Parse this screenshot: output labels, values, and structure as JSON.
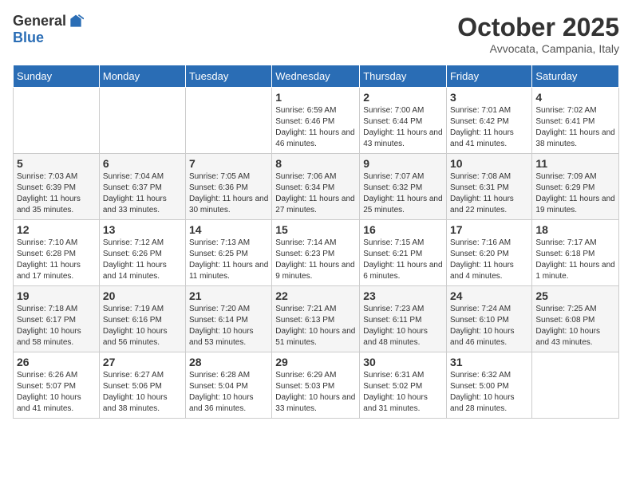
{
  "logo": {
    "general": "General",
    "blue": "Blue"
  },
  "title": "October 2025",
  "subtitle": "Avvocata, Campania, Italy",
  "days_of_week": [
    "Sunday",
    "Monday",
    "Tuesday",
    "Wednesday",
    "Thursday",
    "Friday",
    "Saturday"
  ],
  "weeks": [
    [
      {
        "day": "",
        "info": ""
      },
      {
        "day": "",
        "info": ""
      },
      {
        "day": "",
        "info": ""
      },
      {
        "day": "1",
        "info": "Sunrise: 6:59 AM\nSunset: 6:46 PM\nDaylight: 11 hours and 46 minutes."
      },
      {
        "day": "2",
        "info": "Sunrise: 7:00 AM\nSunset: 6:44 PM\nDaylight: 11 hours and 43 minutes."
      },
      {
        "day": "3",
        "info": "Sunrise: 7:01 AM\nSunset: 6:42 PM\nDaylight: 11 hours and 41 minutes."
      },
      {
        "day": "4",
        "info": "Sunrise: 7:02 AM\nSunset: 6:41 PM\nDaylight: 11 hours and 38 minutes."
      }
    ],
    [
      {
        "day": "5",
        "info": "Sunrise: 7:03 AM\nSunset: 6:39 PM\nDaylight: 11 hours and 35 minutes."
      },
      {
        "day": "6",
        "info": "Sunrise: 7:04 AM\nSunset: 6:37 PM\nDaylight: 11 hours and 33 minutes."
      },
      {
        "day": "7",
        "info": "Sunrise: 7:05 AM\nSunset: 6:36 PM\nDaylight: 11 hours and 30 minutes."
      },
      {
        "day": "8",
        "info": "Sunrise: 7:06 AM\nSunset: 6:34 PM\nDaylight: 11 hours and 27 minutes."
      },
      {
        "day": "9",
        "info": "Sunrise: 7:07 AM\nSunset: 6:32 PM\nDaylight: 11 hours and 25 minutes."
      },
      {
        "day": "10",
        "info": "Sunrise: 7:08 AM\nSunset: 6:31 PM\nDaylight: 11 hours and 22 minutes."
      },
      {
        "day": "11",
        "info": "Sunrise: 7:09 AM\nSunset: 6:29 PM\nDaylight: 11 hours and 19 minutes."
      }
    ],
    [
      {
        "day": "12",
        "info": "Sunrise: 7:10 AM\nSunset: 6:28 PM\nDaylight: 11 hours and 17 minutes."
      },
      {
        "day": "13",
        "info": "Sunrise: 7:12 AM\nSunset: 6:26 PM\nDaylight: 11 hours and 14 minutes."
      },
      {
        "day": "14",
        "info": "Sunrise: 7:13 AM\nSunset: 6:25 PM\nDaylight: 11 hours and 11 minutes."
      },
      {
        "day": "15",
        "info": "Sunrise: 7:14 AM\nSunset: 6:23 PM\nDaylight: 11 hours and 9 minutes."
      },
      {
        "day": "16",
        "info": "Sunrise: 7:15 AM\nSunset: 6:21 PM\nDaylight: 11 hours and 6 minutes."
      },
      {
        "day": "17",
        "info": "Sunrise: 7:16 AM\nSunset: 6:20 PM\nDaylight: 11 hours and 4 minutes."
      },
      {
        "day": "18",
        "info": "Sunrise: 7:17 AM\nSunset: 6:18 PM\nDaylight: 11 hours and 1 minute."
      }
    ],
    [
      {
        "day": "19",
        "info": "Sunrise: 7:18 AM\nSunset: 6:17 PM\nDaylight: 10 hours and 58 minutes."
      },
      {
        "day": "20",
        "info": "Sunrise: 7:19 AM\nSunset: 6:16 PM\nDaylight: 10 hours and 56 minutes."
      },
      {
        "day": "21",
        "info": "Sunrise: 7:20 AM\nSunset: 6:14 PM\nDaylight: 10 hours and 53 minutes."
      },
      {
        "day": "22",
        "info": "Sunrise: 7:21 AM\nSunset: 6:13 PM\nDaylight: 10 hours and 51 minutes."
      },
      {
        "day": "23",
        "info": "Sunrise: 7:23 AM\nSunset: 6:11 PM\nDaylight: 10 hours and 48 minutes."
      },
      {
        "day": "24",
        "info": "Sunrise: 7:24 AM\nSunset: 6:10 PM\nDaylight: 10 hours and 46 minutes."
      },
      {
        "day": "25",
        "info": "Sunrise: 7:25 AM\nSunset: 6:08 PM\nDaylight: 10 hours and 43 minutes."
      }
    ],
    [
      {
        "day": "26",
        "info": "Sunrise: 6:26 AM\nSunset: 5:07 PM\nDaylight: 10 hours and 41 minutes."
      },
      {
        "day": "27",
        "info": "Sunrise: 6:27 AM\nSunset: 5:06 PM\nDaylight: 10 hours and 38 minutes."
      },
      {
        "day": "28",
        "info": "Sunrise: 6:28 AM\nSunset: 5:04 PM\nDaylight: 10 hours and 36 minutes."
      },
      {
        "day": "29",
        "info": "Sunrise: 6:29 AM\nSunset: 5:03 PM\nDaylight: 10 hours and 33 minutes."
      },
      {
        "day": "30",
        "info": "Sunrise: 6:31 AM\nSunset: 5:02 PM\nDaylight: 10 hours and 31 minutes."
      },
      {
        "day": "31",
        "info": "Sunrise: 6:32 AM\nSunset: 5:00 PM\nDaylight: 10 hours and 28 minutes."
      },
      {
        "day": "",
        "info": ""
      }
    ]
  ]
}
